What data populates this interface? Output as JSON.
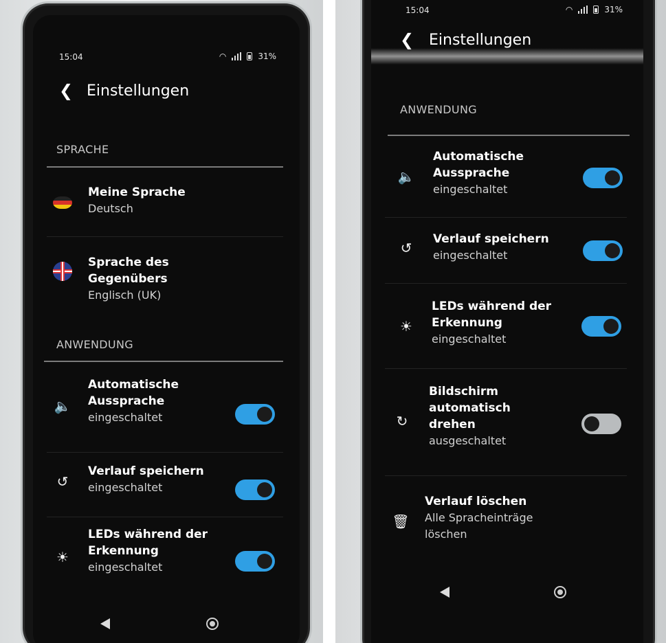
{
  "left": {
    "status": {
      "time": "15:04",
      "battery": "31%"
    },
    "header": {
      "title": "Einstellungen"
    },
    "sections": {
      "language": "SPRACHE",
      "application": "ANWENDUNG"
    },
    "language_items": [
      {
        "title": "Meine Sprache",
        "value": "Deutsch",
        "icon": "german-flag-icon"
      },
      {
        "title": "Sprache des Gegenübers",
        "value": "Englisch (UK)",
        "icon": "uk-flag-icon"
      }
    ],
    "settings": [
      {
        "title_line1": "Automatische",
        "title_line2": "Aussprache",
        "status": "eingeschaltet",
        "on": true,
        "icon": "speaker-icon"
      },
      {
        "title_line1": "Verlauf speichern",
        "title_line2": "",
        "status": "eingeschaltet",
        "on": true,
        "icon": "history-icon"
      },
      {
        "title_line1": "LEDs während der",
        "title_line2": "Erkennung",
        "status": "eingeschaltet",
        "on": true,
        "icon": "sunrise-icon"
      }
    ]
  },
  "right": {
    "status": {
      "time": "15:04",
      "battery": "31%"
    },
    "header": {
      "title": "Einstellungen"
    },
    "sections": {
      "application": "ANWENDUNG"
    },
    "settings": [
      {
        "title_line1": "Automatische",
        "title_line2": "Aussprache",
        "title_line3": "",
        "status": "eingeschaltet",
        "on": true,
        "icon": "speaker-icon"
      },
      {
        "title_line1": "Verlauf speichern",
        "title_line2": "",
        "title_line3": "",
        "status": "eingeschaltet",
        "on": true,
        "icon": "history-icon"
      },
      {
        "title_line1": "LEDs während der",
        "title_line2": "Erkennung",
        "title_line3": "",
        "status": "eingeschaltet",
        "on": true,
        "icon": "sunrise-icon"
      },
      {
        "title_line1": "Bildschirm",
        "title_line2": "automatisch",
        "title_line3": "drehen",
        "status": "ausgeschaltet",
        "on": false,
        "icon": "rotate-icon"
      }
    ],
    "clear": {
      "title": "Verlauf löschen",
      "desc_line1": "Alle Spracheinträge",
      "desc_line2": "löschen",
      "icon": "trash-icon"
    }
  },
  "colors": {
    "toggle_on": "#2f9fe4",
    "toggle_off": "#b9bcbe",
    "screen_bg": "#0c0c0c"
  }
}
